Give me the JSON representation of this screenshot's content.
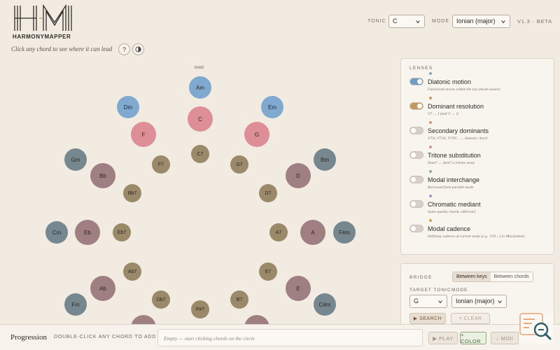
{
  "app": {
    "logo_text": "HARMONYMAPPER",
    "tagline": "Click any chord to see where it can lead",
    "version": "V1.3 · BETA"
  },
  "header": {
    "help_label": "?",
    "theme_icon": "contrast-icon",
    "tonic_label": "TONIC",
    "tonic_value": "C",
    "mode_label": "MODE",
    "mode_value": "Ionian (major)"
  },
  "circle": {
    "tonic_caption": "tonic",
    "colors": {
      "blue": "#7fa9cf",
      "pink": "#de8e97",
      "mauve": "#a07f83",
      "slate": "#76878f",
      "olive": "#9a8a69"
    },
    "chords": [
      {
        "label": "Am",
        "color": "blue"
      },
      {
        "label": "Dm",
        "color": "blue"
      },
      {
        "label": "Em",
        "color": "blue"
      },
      {
        "label": "C",
        "color": "pink"
      },
      {
        "label": "F",
        "color": "pink"
      },
      {
        "label": "G",
        "color": "pink"
      },
      {
        "label": "C7",
        "color": "olive"
      },
      {
        "label": "F7",
        "color": "olive"
      },
      {
        "label": "G7",
        "color": "olive"
      },
      {
        "label": "Gm",
        "color": "slate"
      },
      {
        "label": "Bm",
        "color": "slate"
      },
      {
        "label": "Bb",
        "color": "mauve"
      },
      {
        "label": "D",
        "color": "mauve"
      },
      {
        "label": "Bb7",
        "color": "olive"
      },
      {
        "label": "D7",
        "color": "olive"
      },
      {
        "label": "Cm",
        "color": "slate"
      },
      {
        "label": "Eb",
        "color": "mauve"
      },
      {
        "label": "Eb7",
        "color": "olive"
      },
      {
        "label": "A7",
        "color": "olive"
      },
      {
        "label": "A",
        "color": "mauve"
      },
      {
        "label": "F#m",
        "color": "slate"
      },
      {
        "label": "Ab7",
        "color": "olive"
      },
      {
        "label": "E7",
        "color": "olive"
      },
      {
        "label": "Ab",
        "color": "mauve"
      },
      {
        "label": "E",
        "color": "mauve"
      },
      {
        "label": "Fm",
        "color": "slate"
      },
      {
        "label": "C#m",
        "color": "slate"
      },
      {
        "label": "Db7",
        "color": "olive"
      },
      {
        "label": "B7",
        "color": "olive"
      },
      {
        "label": "F#7",
        "color": "olive"
      },
      {
        "label": "",
        "color": "mauve"
      },
      {
        "label": "",
        "color": "mauve"
      }
    ]
  },
  "lenses": {
    "title": "LENSES",
    "items": [
      {
        "name": "Diatonic motion",
        "desc": "Functional moves within the key (mode-aware)",
        "on": true,
        "dot": "#7fa9cf",
        "track": "#6f9cc5"
      },
      {
        "name": "Dominant resolution",
        "desc": "V7 → I (and V → i)",
        "on": true,
        "dot": "#c39a5e",
        "track": "#c39a5e"
      },
      {
        "name": "Secondary dominants",
        "desc": "V7/ii, V7/iii, V7/IV... → diatonic chord",
        "on": false,
        "dot": "#e08f7a",
        "track": ""
      },
      {
        "name": "Tritone substitution",
        "desc": "Dom7 ↔ dom7 a tritone away",
        "on": false,
        "dot": "#de8e97",
        "track": ""
      },
      {
        "name": "Modal interchange",
        "desc": "Borrowed from parallel mode",
        "on": false,
        "dot": "#8fb083",
        "track": ""
      },
      {
        "name": "Chromatic mediant",
        "desc": "Same-quality chords ±M3/±m3",
        "on": false,
        "dot": "#a591c9",
        "track": ""
      },
      {
        "name": "Modal cadence",
        "desc": "Defining cadence of current mode (e.g. ♭VII→I in Mixolydian)",
        "on": false,
        "dot": "#c8a74e",
        "track": ""
      }
    ]
  },
  "bridge": {
    "title": "BRIDGE",
    "tab_keys": "Between keys",
    "tab_chords": "Between chords",
    "target_tonic_label": "TARGET TONIC",
    "mode_label": "MODE",
    "target_tonic_value": "G",
    "mode_value": "Ionian (major)",
    "search_label": "▶ SEARCH",
    "clear_label": "× CLEAR"
  },
  "progression": {
    "title": "Progression",
    "hint": "DOUBLE-CLICK ANY CHORD TO ADD",
    "empty_text": "Empty — start clicking chords on the circle",
    "play_label": "▶ PLAY",
    "color_label": "+ COLOR",
    "midi_label": "↓ MIDI"
  }
}
